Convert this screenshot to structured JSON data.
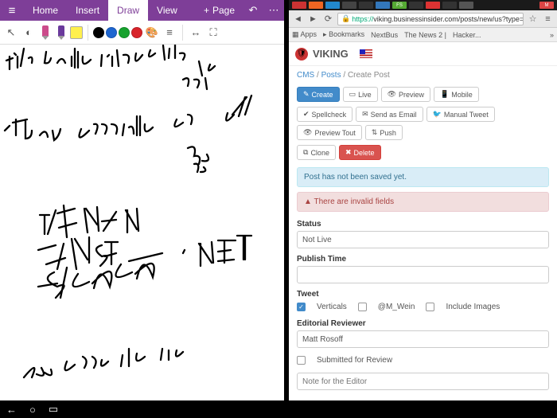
{
  "onenote": {
    "tabs": {
      "home": "Home",
      "insert": "Insert",
      "draw": "Draw",
      "view": "View"
    },
    "add_page": "Page",
    "handwriting_lines": [
      "1) i's really interesting to ...",
      "dev",
      "They generally go aff",
      "ma",
      "co",
      "1) AMZN",
      "2) MSFT — .NET",
      "3) GOOG"
    ]
  },
  "browser": {
    "url": "viking.businessinsider.com/posts/new/us?type=",
    "scheme": "https://",
    "bookmarks": {
      "apps": "Apps",
      "bookmarks": "Bookmarks",
      "nextbus": "NextBus",
      "news2": "The News 2 |",
      "hacker": "Hacker..."
    }
  },
  "viking": {
    "name": "VIKING",
    "crumb": {
      "cms": "CMS",
      "posts": "Posts",
      "create": "Create Post"
    },
    "row1": {
      "create": "Create",
      "live": "Live",
      "preview": "Preview",
      "mobile": "Mobile"
    },
    "row2": {
      "spell": "Spellcheck",
      "email": "Send as Email",
      "tweet": "Manual Tweet",
      "tout": "Preview Tout",
      "push": "Push"
    },
    "row3": {
      "clone": "Clone",
      "delete": "Delete"
    },
    "alert_info": "Post has not been saved yet.",
    "alert_err": "There are invalid fields",
    "status": {
      "label": "Status",
      "value": "Not Live"
    },
    "publish": {
      "label": "Publish Time",
      "value": ""
    },
    "tweet": {
      "label": "Tweet",
      "verticals": "Verticals",
      "mwein": "@M_Wein",
      "images": "Include Images"
    },
    "reviewer": {
      "label": "Editorial Reviewer",
      "value": "Matt Rosoff"
    },
    "submitted": "Submitted for Review",
    "note_ph": "Note for the Editor"
  }
}
